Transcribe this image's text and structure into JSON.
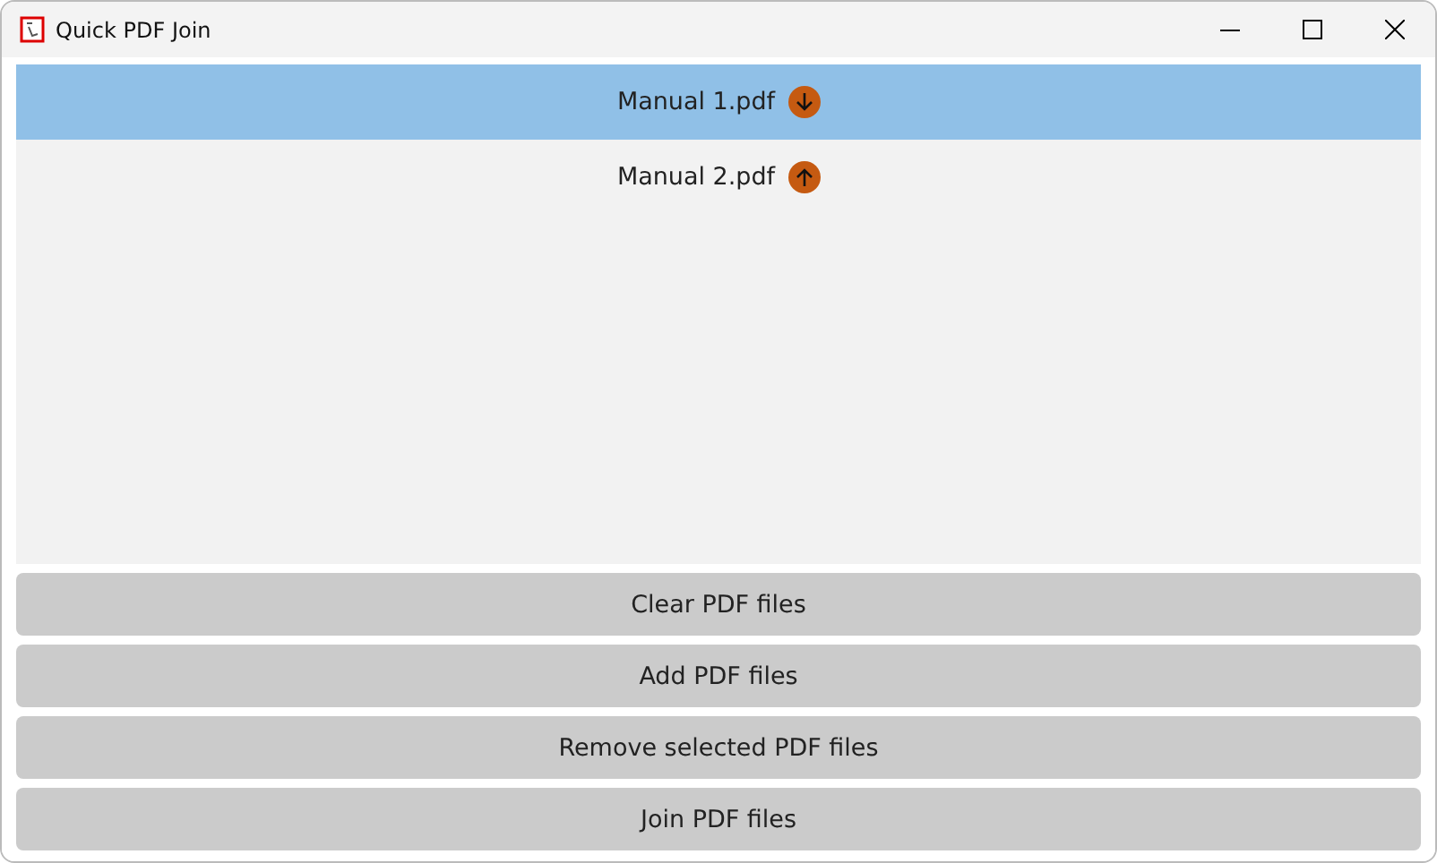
{
  "window": {
    "title": "Quick PDF Join"
  },
  "files": [
    {
      "name": "Manual 1.pdf",
      "selected": true,
      "kind": "down"
    },
    {
      "name": "Manual 2.pdf",
      "selected": false,
      "kind": "up"
    }
  ],
  "buttons": [
    "Clear PDF files",
    "Add PDF files",
    "Remove selected PDF files",
    "Join PDF files"
  ]
}
